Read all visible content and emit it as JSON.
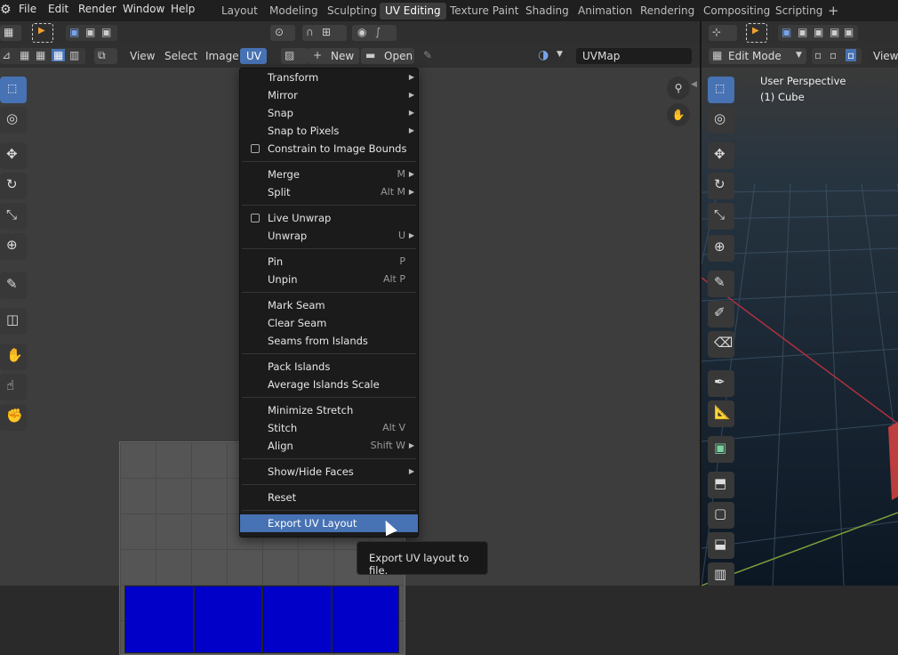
{
  "topbar": {
    "menus": [
      "File",
      "Edit",
      "Render",
      "Window",
      "Help"
    ],
    "workspaces": [
      "Layout",
      "Modeling",
      "Sculpting",
      "UV Editing",
      "Texture Paint",
      "Shading",
      "Animation",
      "Rendering",
      "Compositing",
      "Scripting"
    ],
    "active_workspace": "UV Editing",
    "add_tab": "+"
  },
  "uv_editor": {
    "menus": {
      "view": "View",
      "select": "Select",
      "image": "Image",
      "uv": "UV"
    },
    "new_label": "New",
    "open_label": "Open",
    "uvmap_field": "UVMap"
  },
  "uv_menu": {
    "items": [
      {
        "label": "Transform",
        "submenu": true
      },
      {
        "label": "Mirror",
        "submenu": true
      },
      {
        "label": "Snap",
        "submenu": true
      },
      {
        "label": "Snap to Pixels",
        "submenu": true
      },
      {
        "label": "Constrain to Image Bounds",
        "checkbox": true
      },
      {
        "label": "Merge",
        "shortcut": "M",
        "submenu": true
      },
      {
        "label": "Split",
        "shortcut": "Alt M",
        "submenu": true
      },
      {
        "label": "Live Unwrap",
        "checkbox": true
      },
      {
        "label": "Unwrap",
        "shortcut": "U",
        "submenu": true
      },
      {
        "label": "Pin",
        "shortcut": "P"
      },
      {
        "label": "Unpin",
        "shortcut": "Alt P"
      },
      {
        "label": "Mark Seam"
      },
      {
        "label": "Clear Seam"
      },
      {
        "label": "Seams from Islands"
      },
      {
        "label": "Pack Islands"
      },
      {
        "label": "Average Islands Scale"
      },
      {
        "label": "Minimize Stretch"
      },
      {
        "label": "Stitch",
        "shortcut": "Alt V"
      },
      {
        "label": "Align",
        "shortcut": "Shift W",
        "submenu": true
      },
      {
        "label": "Show/Hide Faces",
        "submenu": true
      },
      {
        "label": "Reset"
      },
      {
        "label": "Export UV Layout",
        "highlighted": true
      }
    ],
    "tooltip": "Export UV layout to file."
  },
  "viewport": {
    "mode": "Edit Mode",
    "view_label": "View",
    "overlay_line1": "User Perspective",
    "overlay_line2": "(1) Cube"
  },
  "colors": {
    "accent": "#4772b3",
    "uv_face": "#0000c8",
    "menu_bg": "#1b1b1b"
  }
}
